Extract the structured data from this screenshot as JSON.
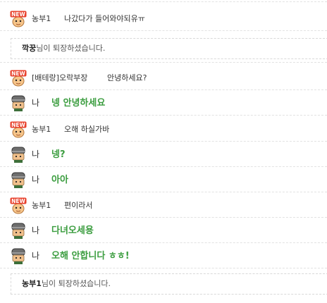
{
  "messages": [
    {
      "kind": "chat",
      "is_me": false,
      "avatar": "new-user-avatar-icon",
      "badge": "NEW",
      "sender": "농부1",
      "text": "나갔다가 들어와야되유ㅠ"
    },
    {
      "kind": "system",
      "name": "깍꿍",
      "suffix": "님이 퇴장하셨습니다."
    },
    {
      "kind": "chat",
      "is_me": false,
      "avatar": "new-user-avatar-icon",
      "badge": "NEW",
      "sender": "[배테랑]오락부장",
      "text": "안녕하세요?"
    },
    {
      "kind": "chat",
      "is_me": true,
      "avatar": "helmet-avatar-icon",
      "sender": "나",
      "text": "넹 안녕하세요"
    },
    {
      "kind": "chat",
      "is_me": false,
      "avatar": "new-user-avatar-icon",
      "badge": "NEW",
      "sender": "농부1",
      "text": "오해 하실가바"
    },
    {
      "kind": "chat",
      "is_me": true,
      "avatar": "helmet-avatar-icon",
      "sender": "나",
      "text": "넹?"
    },
    {
      "kind": "chat",
      "is_me": true,
      "avatar": "helmet-avatar-icon",
      "sender": "나",
      "text": "아아"
    },
    {
      "kind": "chat",
      "is_me": false,
      "avatar": "new-user-avatar-icon",
      "badge": "NEW",
      "sender": "농부1",
      "text": "편이라서"
    },
    {
      "kind": "chat",
      "is_me": true,
      "avatar": "helmet-avatar-icon",
      "sender": "나",
      "text": "다녀오세용"
    },
    {
      "kind": "chat",
      "is_me": true,
      "avatar": "helmet-avatar-icon",
      "sender": "나",
      "text": "오해 안합니다 ㅎㅎ!"
    },
    {
      "kind": "system",
      "name": "농부1",
      "suffix": "님이 퇴장하셨습니다."
    }
  ],
  "colors": {
    "my_message": "#3b9d3f",
    "other_message": "#333333",
    "badge_red": "#e8412c",
    "divider": "#d8d8d8"
  }
}
